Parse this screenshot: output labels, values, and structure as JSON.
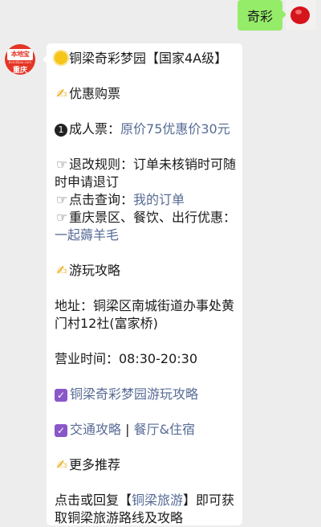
{
  "outgoing": {
    "text": "奇彩"
  },
  "incoming_avatar": {
    "badge": "本地宝",
    "sub": "bendibao.com",
    "city": "重庆"
  },
  "message": {
    "title": "铜梁奇彩梦园【国家4A级】",
    "section_tickets": "优惠购票",
    "ticket_label": "成人票：",
    "ticket_price": "原价75优惠价30元",
    "refund_line1": "退改规则：订单未核销时可随",
    "refund_line2": "时申请退订",
    "query_label": "点击查询：",
    "query_link": "我的订单",
    "deals_label": "重庆景区、餐饮、出行优惠：",
    "deals_link": "一起薅羊毛",
    "section_guide": "游玩攻略",
    "address_line1": "地址：铜梁区南城街道办事处黄",
    "address_line2": "门村12社(富家桥)",
    "hours": "营业时间：08:30-20:30",
    "guide_link": "铜梁奇彩梦园游玩攻略",
    "traffic_link": "交通攻略",
    "separator": " | ",
    "dining_link": "餐厅&住宿",
    "section_more": "更多推荐",
    "more_prefix": "点击或回复【",
    "more_link": "铜梁旅游",
    "more_suffix": "】即可获",
    "more_line2": "取铜梁旅游路线及攻略"
  },
  "icons": {
    "title": "sun-icon",
    "sections": "writing-hand-icon",
    "number": "circled-one-icon",
    "pointer": "pointing-hand-icon",
    "check": "checkbox-icon"
  },
  "colors": {
    "link": "#576b95",
    "outgoing_bubble": "#95ec69",
    "background": "#ededed"
  }
}
